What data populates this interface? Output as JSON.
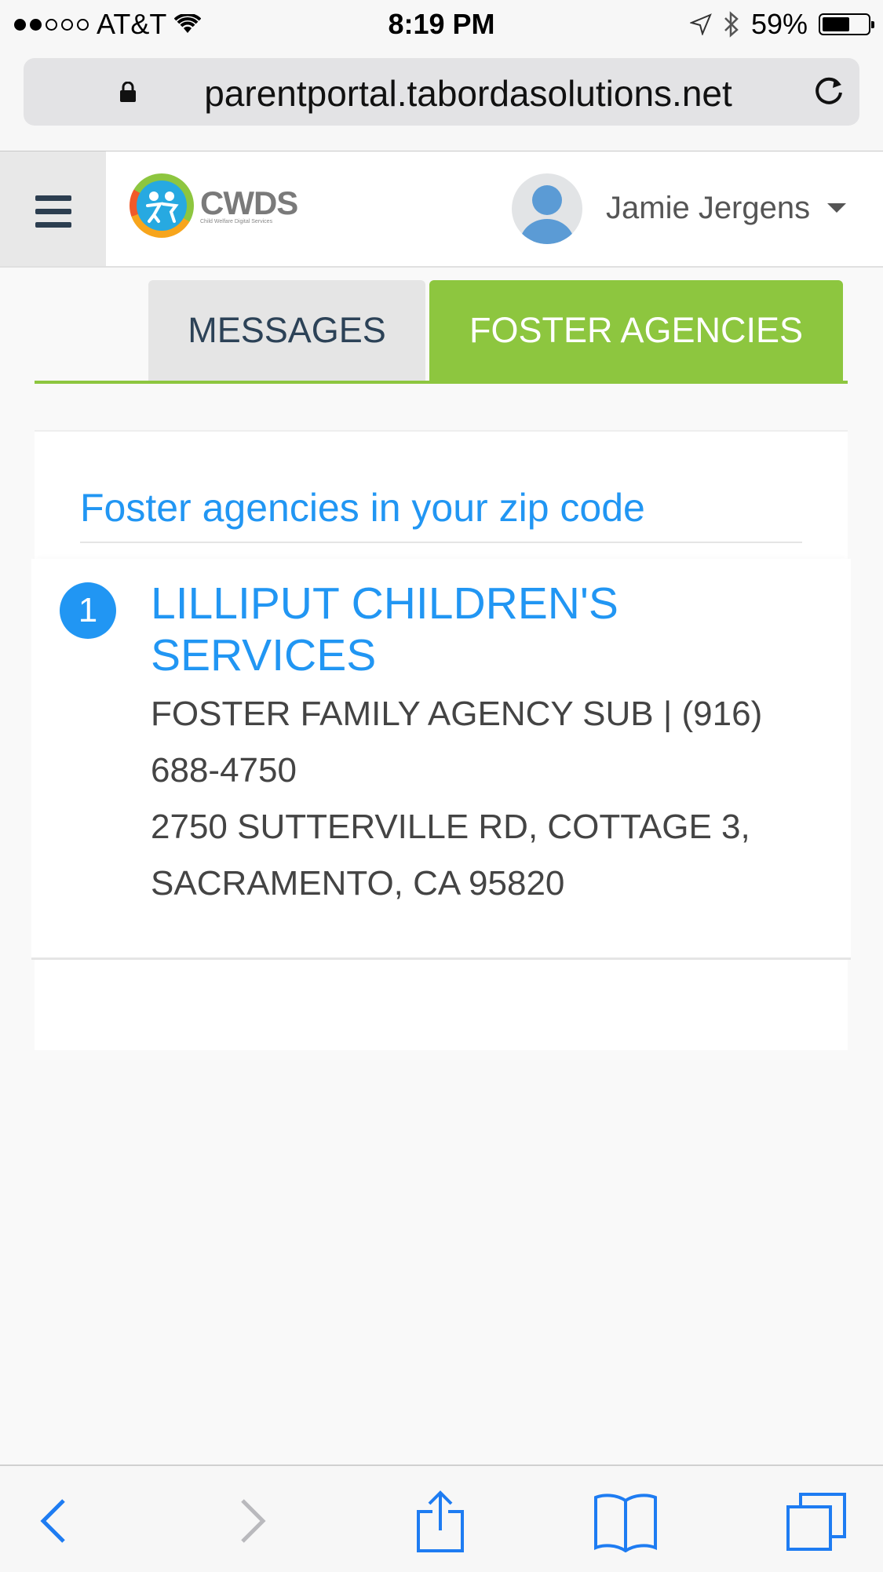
{
  "status_bar": {
    "carrier": "AT&T",
    "time": "8:19 PM",
    "battery": "59%",
    "battery_level": 0.59
  },
  "browser": {
    "url": "parentportal.tabordasolutions.net"
  },
  "header": {
    "logo_text": "CWDS",
    "logo_subtext": "Child Welfare Digital Services",
    "user_name": "Jamie Jergens"
  },
  "tabs": [
    {
      "label": "MESSAGES",
      "active": false
    },
    {
      "label": "FOSTER AGENCIES",
      "active": true
    }
  ],
  "agencies_section": {
    "title": "Foster agencies in your zip code",
    "items": [
      {
        "number": "1",
        "name": "LILLIPUT CHILDREN'S SERVICES",
        "type_phone": "FOSTER FAMILY AGENCY SUB | (916) 688-4750",
        "address": "2750 SUTTERVILLE RD, COTTAGE 3, SACRAMENTO, CA 95820"
      }
    ]
  },
  "colors": {
    "accent_blue": "#2196f3",
    "accent_green": "#8dc63f",
    "safari_blue": "#1e7cf2"
  },
  "toolbar_icons": [
    "back-icon",
    "forward-icon",
    "share-icon",
    "bookmarks-icon",
    "tabs-icon"
  ]
}
